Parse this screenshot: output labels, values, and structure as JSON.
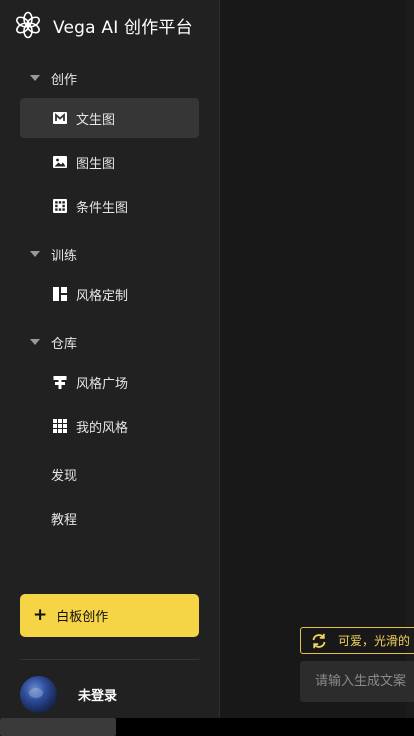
{
  "brand": {
    "title": "Vega AI 创作平台",
    "logo_icon": "flower-logo-icon"
  },
  "sections": {
    "create": {
      "label": "创作",
      "items": [
        {
          "label": "文生图",
          "icon": "m-letter-icon"
        },
        {
          "label": "图生图",
          "icon": "image-icon"
        },
        {
          "label": "条件生图",
          "icon": "grid-dots-icon"
        }
      ]
    },
    "train": {
      "label": "训练",
      "items": [
        {
          "label": "风格定制",
          "icon": "layout-blocks-icon"
        }
      ]
    },
    "library": {
      "label": "仓库",
      "items": [
        {
          "label": "风格广场",
          "icon": "signpost-icon"
        },
        {
          "label": "我的风格",
          "icon": "grid-icon"
        }
      ]
    }
  },
  "nav_extra": {
    "discover": "发现",
    "tutorial": "教程"
  },
  "whiteboard": {
    "label": "白板创作",
    "plus": "+"
  },
  "user": {
    "name": "未登录"
  },
  "main": {
    "prompt_suggestion": "可爱，光滑的",
    "prompt_placeholder": "请输入生成文案"
  },
  "colors": {
    "sidebar_bg": "#212121",
    "accent_yellow": "#f5d445",
    "active_item_bg": "#363636"
  }
}
